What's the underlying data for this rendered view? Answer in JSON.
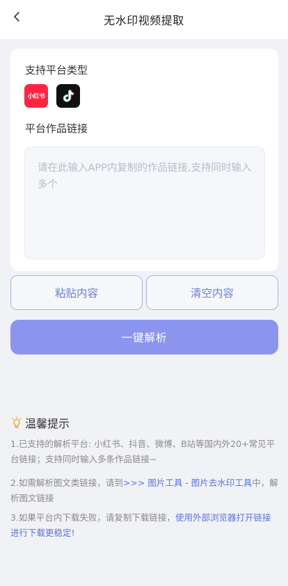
{
  "header": {
    "title": "无水印视频提取",
    "back_icon": "chevron-left-icon"
  },
  "form": {
    "platforms_label": "支持平台类型",
    "platforms": [
      {
        "name": "小红书",
        "icon": "xiaohongshu-icon",
        "color": "#ff2442"
      },
      {
        "name": "抖音",
        "icon": "douyin-icon",
        "color": "#111111"
      }
    ],
    "link_label": "平台作品链接",
    "link_value": "",
    "link_placeholder": "请在此输入APP内复制的作品链接,支持同时输入多个"
  },
  "actions": {
    "paste_label": "粘贴内容",
    "clear_label": "清空内容",
    "parse_label": "一键解析"
  },
  "tips": {
    "title": "温馨提示",
    "icon": "lightbulb-icon",
    "item1": "1.已支持的解析平台: 小红书、抖音、微博、B站等国内外20+常见平台链接；支持同时输入多条作品链接~",
    "item2_prefix": "2.如需解析图文类链接，请到",
    "item2_link": ">>> 图片工具 - 图片去水印工具",
    "item2_suffix": "中，解析图文链接",
    "item3_prefix": "3.如果平台内下载失败，请复制下载链接，",
    "item3_link": "使用外部浏览器打开链接进行下载更稳定!"
  },
  "colors": {
    "accent": "#8b95f0",
    "accent_text": "#6b7fd6",
    "link": "#5a73d8",
    "background": "#f1f2f6"
  }
}
